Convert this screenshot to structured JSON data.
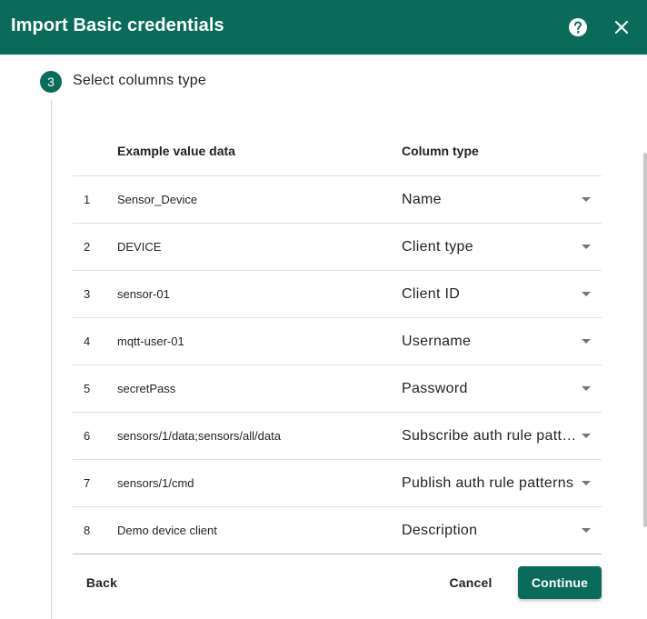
{
  "dialog": {
    "title": "Import Basic credentials",
    "help_icon": "help-circle-icon",
    "close_icon": "close-icon"
  },
  "step": {
    "number": "3",
    "title": "Select columns type"
  },
  "table": {
    "headers": {
      "example": "Example value data",
      "type": "Column type"
    },
    "rows": [
      {
        "index": "1",
        "example": "Sensor_Device",
        "type": "Name"
      },
      {
        "index": "2",
        "example": "DEVICE",
        "type": "Client type"
      },
      {
        "index": "3",
        "example": "sensor-01",
        "type": "Client ID"
      },
      {
        "index": "4",
        "example": "mqtt-user-01",
        "type": "Username"
      },
      {
        "index": "5",
        "example": "secretPass",
        "type": "Password"
      },
      {
        "index": "6",
        "example": "sensors/1/data;sensors/all/data",
        "type": "Subscribe auth rule patterns"
      },
      {
        "index": "7",
        "example": "sensors/1/cmd",
        "type": "Publish auth rule patterns"
      },
      {
        "index": "8",
        "example": "Demo device client",
        "type": "Description"
      }
    ]
  },
  "actions": {
    "back": "Back",
    "cancel": "Cancel",
    "continue": "Continue"
  },
  "colors": {
    "primary": "#0b6b5b"
  }
}
